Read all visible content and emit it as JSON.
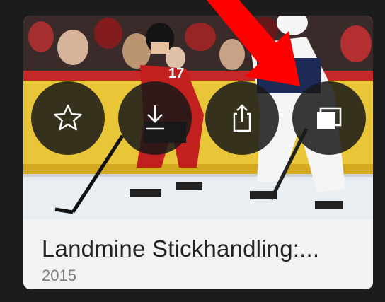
{
  "card": {
    "title": "Landmine Stickhandling:...",
    "year": "2015"
  },
  "actions": [
    {
      "icon": "star-icon",
      "label": ""
    },
    {
      "icon": "download-icon",
      "label": ""
    },
    {
      "icon": "share-icon",
      "label": ""
    },
    {
      "icon": "copy-windows-icon",
      "label": ""
    }
  ],
  "thumbnail": {
    "player_number": "17",
    "accent_color": "#d92323",
    "overlay_color": "#181818"
  },
  "annotation": {
    "arrow_color": "#ff0000"
  }
}
